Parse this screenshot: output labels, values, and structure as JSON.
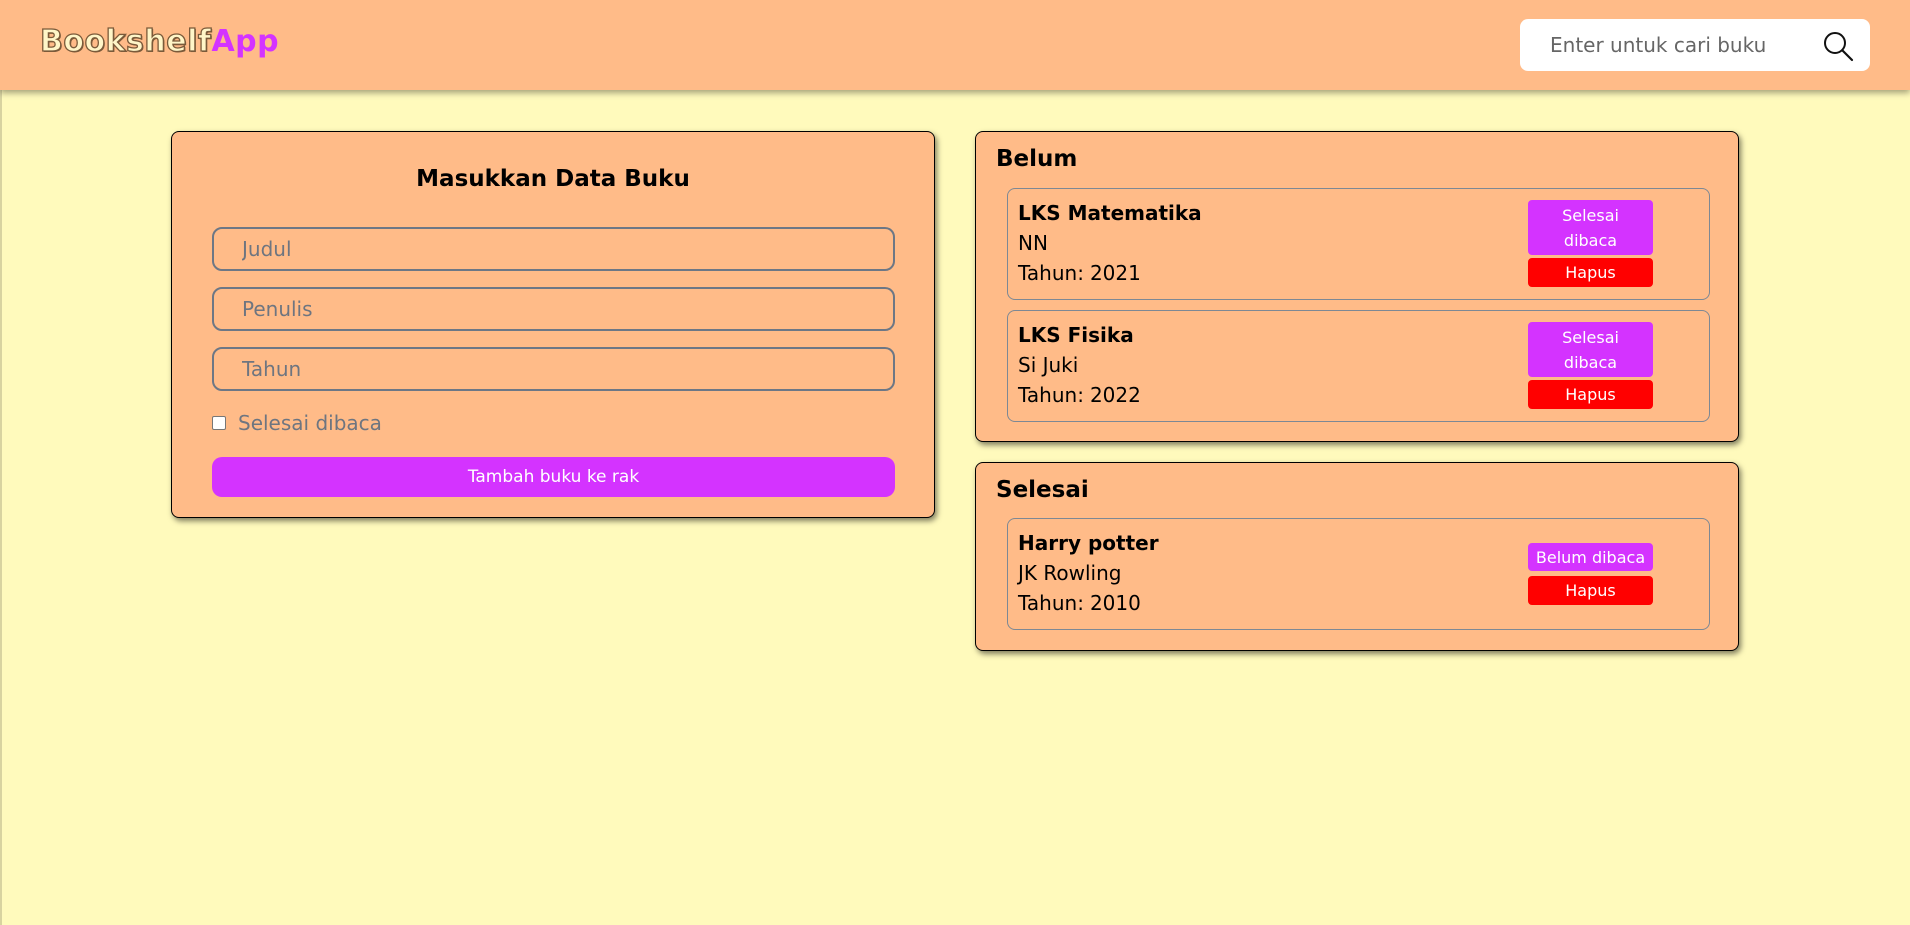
{
  "header": {
    "logo_part1": "Bookshelf",
    "logo_part2": "App",
    "search_placeholder": "Enter untuk cari buku",
    "search_icon": "search-icon"
  },
  "colors": {
    "background": "#fffabc",
    "header_card": "#ffbb88",
    "accent_purple": "#d433ff",
    "danger_red": "#ff0000"
  },
  "form": {
    "title": "Masukkan Data Buku",
    "title_placeholder": "Judul",
    "author_placeholder": "Penulis",
    "year_placeholder": "Tahun",
    "checkbox_label": "Selesai dibaca",
    "checkbox_checked": false,
    "submit_label": "Tambah buku ke rak"
  },
  "shelves": {
    "belum": {
      "title": "Belum",
      "books": [
        {
          "title": "LKS Matematika",
          "author": "NN",
          "year_label": "Tahun:",
          "year": "2021",
          "toggle_label": "Selesai dibaca",
          "delete_label": "Hapus"
        },
        {
          "title": "LKS Fisika",
          "author": "Si Juki",
          "year_label": "Tahun:",
          "year": "2022",
          "toggle_label": "Selesai dibaca",
          "delete_label": "Hapus"
        }
      ]
    },
    "selesai": {
      "title": "Selesai",
      "books": [
        {
          "title": "Harry potter",
          "author": "JK Rowling",
          "year_label": "Tahun:",
          "year": "2010",
          "toggle_label": "Belum dibaca",
          "delete_label": "Hapus"
        }
      ]
    }
  }
}
